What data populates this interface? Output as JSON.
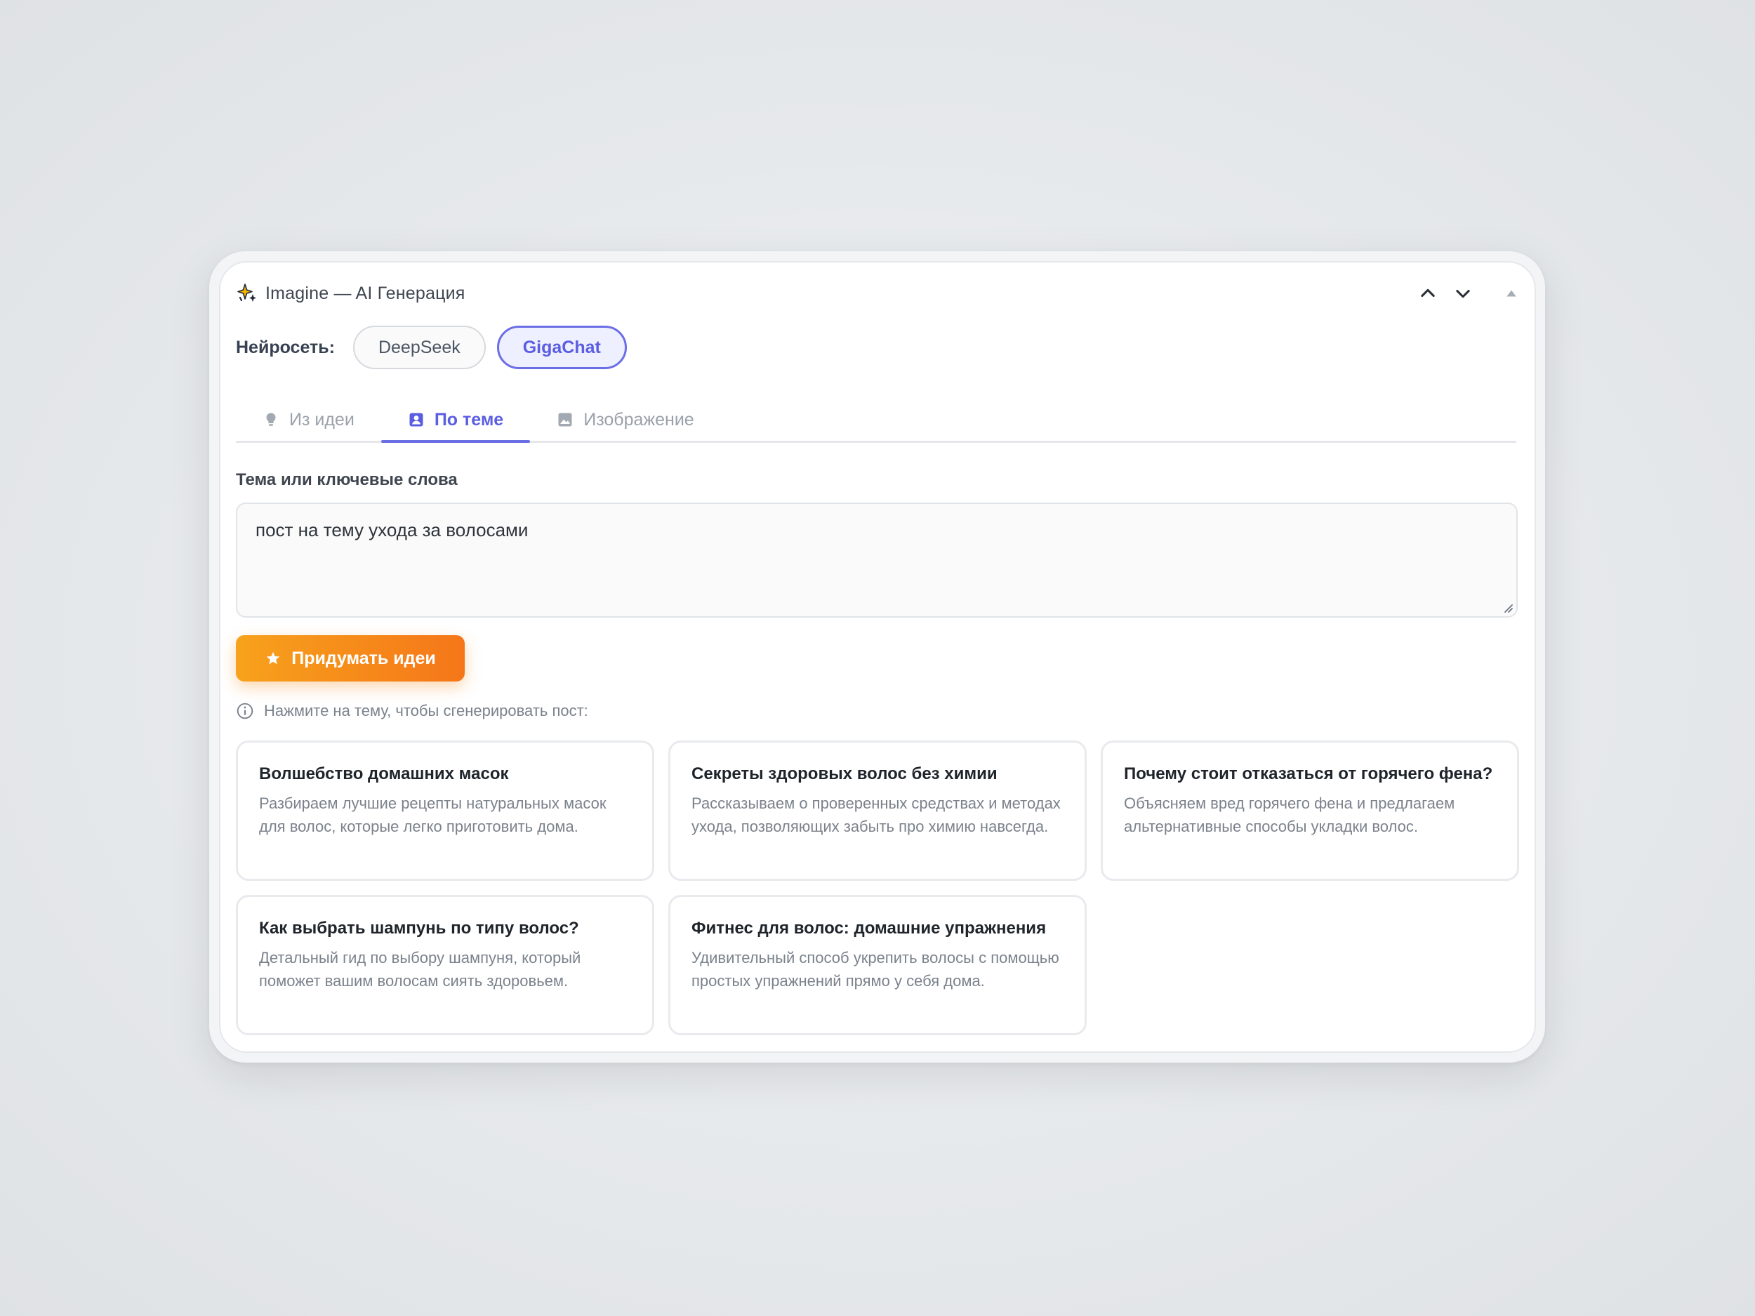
{
  "window": {
    "title": "Imagine — AI Генерация"
  },
  "model": {
    "label": "Нейросеть:",
    "options": [
      "DeepSeek",
      "GigaChat"
    ],
    "selected": "GigaChat"
  },
  "tabs": [
    {
      "label": "Из идеи",
      "icon": "lightbulb-icon",
      "active": false
    },
    {
      "label": "По теме",
      "icon": "contact-card-icon",
      "active": true
    },
    {
      "label": "Изображение",
      "icon": "image-icon",
      "active": false
    }
  ],
  "topic": {
    "label": "Тема или ключевые слова",
    "value": "пост на тему ухода за волосами"
  },
  "generate_button": {
    "label": "Придумать идеи",
    "icon": "star-icon"
  },
  "hint": {
    "text": "Нажмите на тему, чтобы сгенерировать пост:",
    "icon": "info-icon"
  },
  "ideas": [
    {
      "title": "Волшебство домашних масок",
      "description": "Разбираем лучшие рецепты натуральных масок для волос, которые легко приготовить дома."
    },
    {
      "title": "Секреты здоровых волос без химии",
      "description": "Рассказываем о проверенных средствах и методах ухода, позволяющих забыть про химию навсегда."
    },
    {
      "title": "Почему стоит отказаться от горячего фена?",
      "description": "Объясняем вред горячего фена и предлагаем альтернативные способы укладки волос."
    },
    {
      "title": "Как выбрать шампунь по типу волос?",
      "description": "Детальный гид по выбору шампуня, который поможет вашим волосам сиять здоровьем."
    },
    {
      "title": "Фитнес для волос: домашние упражнения",
      "description": "Удивительный способ укрепить волосы с помощью простых упражнений прямо у себя дома."
    }
  ],
  "colors": {
    "accent": "#6c6ee6",
    "cta_start": "#f7a21c",
    "cta_end": "#f57619"
  }
}
